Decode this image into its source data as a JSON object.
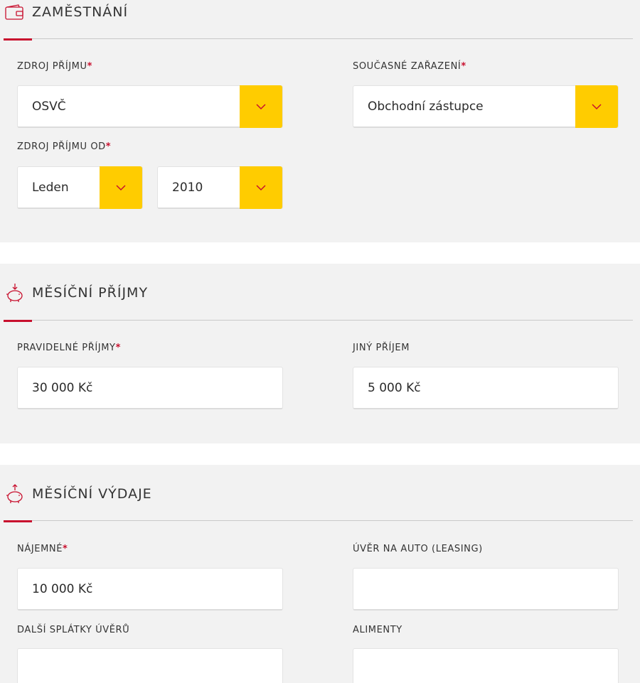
{
  "employment": {
    "title": "ZAMĚSTNÁNÍ",
    "icon": "wallet-icon",
    "income_source": {
      "label": "ZDROJ PŘÍJMU",
      "required": "*",
      "value": "OSVČ"
    },
    "position": {
      "label": "SOUČASNÉ ZAŘAZENÍ",
      "required": "*",
      "value": "Obchodní zástupce"
    },
    "income_since": {
      "label": "ZDROJ PŘÍJMU OD",
      "required": "*",
      "month": "Leden",
      "year": "2010"
    }
  },
  "monthly_income": {
    "title": "MĚSÍČNÍ PŘÍJMY",
    "icon": "piggy-bank-in-icon",
    "regular": {
      "label": "PRAVIDELNÉ PŘÍJMY",
      "required": "*",
      "value": "30 000 Kč"
    },
    "other": {
      "label": "JINÝ PŘÍJEM",
      "value": "5 000 Kč"
    }
  },
  "monthly_expenses": {
    "title": "MĚSÍČNÍ VÝDAJE",
    "icon": "piggy-bank-out-icon",
    "rent": {
      "label": "NÁJEMNÉ",
      "required": "*",
      "value": "10 000 Kč"
    },
    "car_loan": {
      "label": "ÚVĚR NA AUTO (LEASING)",
      "value": ""
    },
    "other_loans": {
      "label": "DALŠÍ SPLÁTKY ÚVĚRŮ",
      "value": ""
    },
    "alimony": {
      "label": "ALIMENTY",
      "value": ""
    }
  },
  "colors": {
    "accent": "#c8102e",
    "dropdown": "#ffcc00",
    "panel": "#f2f2f2"
  }
}
